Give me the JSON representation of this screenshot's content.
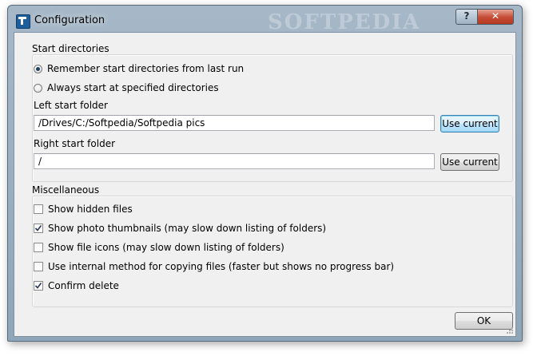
{
  "window": {
    "title": "Configuration",
    "watermark": "SOFTPEDIA",
    "help_glyph": "?",
    "close_glyph": "✕"
  },
  "start_directories": {
    "title": "Start directories",
    "options": [
      {
        "label": "Remember start directories from last run",
        "checked": true
      },
      {
        "label": "Always start at specified directories",
        "checked": false
      }
    ],
    "left": {
      "label": "Left start folder",
      "value": "/Drives/C:/Softpedia/Softpedia pics",
      "button": "Use current"
    },
    "right": {
      "label": "Right start folder",
      "value": "/",
      "button": "Use current"
    }
  },
  "misc": {
    "title": "Miscellaneous",
    "items": [
      {
        "label": "Show hidden files",
        "checked": false
      },
      {
        "label": "Show photo thumbnails (may slow down listing of folders)",
        "checked": true
      },
      {
        "label": "Show file icons (may slow down listing of folders)",
        "checked": false
      },
      {
        "label": "Use internal method for copying files (faster but shows no progress bar)",
        "checked": false
      },
      {
        "label": "Confirm delete",
        "checked": true
      }
    ]
  },
  "footer": {
    "ok": "OK"
  },
  "icons": {
    "app": "app-icon",
    "help": "help-icon",
    "close": "close-icon"
  }
}
